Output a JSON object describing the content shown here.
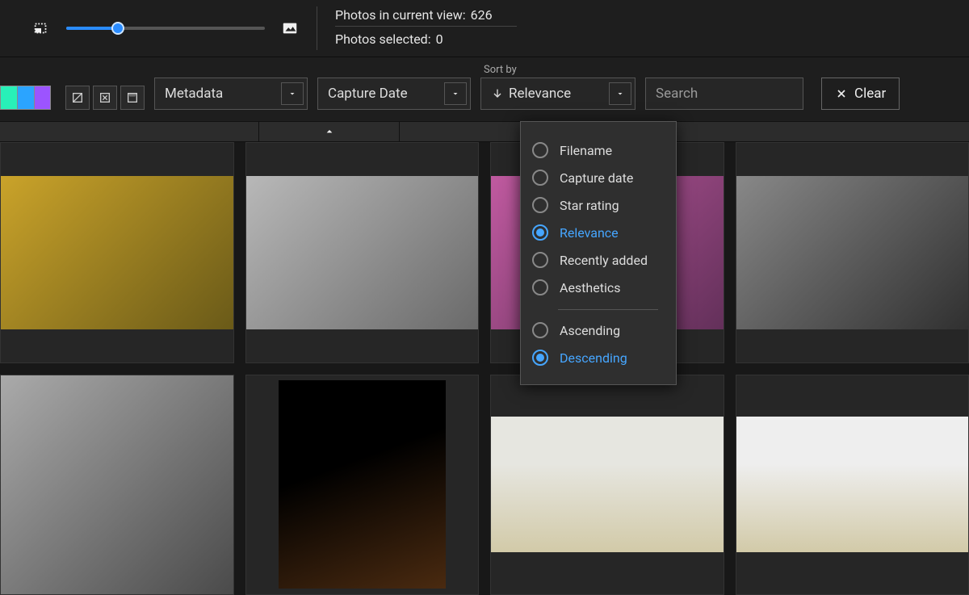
{
  "topbar": {
    "status_view_label": "Photos in current view:",
    "status_view_count": "626",
    "status_selected_label": "Photos selected:",
    "status_selected_count": "0",
    "thumb_slider_pct": 26
  },
  "toolbar": {
    "color_filters": [
      "cyan",
      "blue",
      "purple"
    ],
    "combo_metadata": "Metadata",
    "combo_capture": "Capture Date",
    "sort_label": "Sort by",
    "sort_current": "Relevance",
    "search_placeholder": "Search",
    "clear_label": "Clear"
  },
  "sort_menu": {
    "options": [
      {
        "key": "filename",
        "label": "Filename",
        "selected": false
      },
      {
        "key": "capture",
        "label": "Capture date",
        "selected": false
      },
      {
        "key": "star",
        "label": "Star rating",
        "selected": false
      },
      {
        "key": "relevance",
        "label": "Relevance",
        "selected": true
      },
      {
        "key": "recent",
        "label": "Recently added",
        "selected": false
      },
      {
        "key": "aesthetics",
        "label": "Aesthetics",
        "selected": false
      }
    ],
    "order": [
      {
        "key": "asc",
        "label": "Ascending",
        "selected": false
      },
      {
        "key": "desc",
        "label": "Descending",
        "selected": true
      }
    ]
  }
}
